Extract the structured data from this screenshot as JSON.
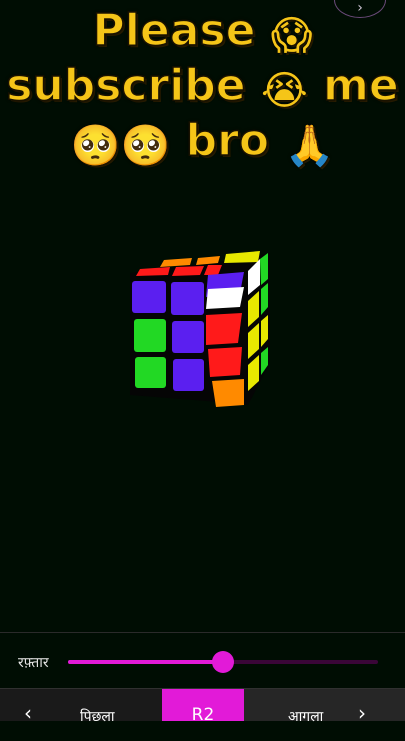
{
  "overlay": {
    "line1": "Please",
    "line1_emoji": "😱",
    "line2": "subscribe",
    "line2_emoji": "😭",
    "line2_end": "me",
    "line3_emoji": "🥺🥺",
    "line3": "bro",
    "line3_end_emoji": "🙏"
  },
  "top_button_icon": "chevron-right-icon",
  "controls": {
    "speed_label": "रफ़्तार",
    "speed_value": 0.5,
    "accent_color": "#e21ad8"
  },
  "nav": {
    "prev_label": "पिछला",
    "current_move": "R2",
    "next_label": "आगला",
    "prev_icon": "chevron-left-icon",
    "next_icon": "chevron-right-icon"
  },
  "cube": {
    "front_face": [
      "#5b1ff0",
      "#5b1ff0",
      "#5b1ff0",
      "#22d824",
      "#5b1ff0",
      "#5b1ff0",
      "#22d824",
      "#5b1ff0",
      "#5b1ff0"
    ],
    "right_face": [
      "#ffffff",
      "#e8e800",
      "#22d824",
      "#ff1a1a",
      "#e8e800",
      "#22d824",
      "#ff1a1a",
      "#e8e800",
      "#e8e800",
      "#ff8a00"
    ],
    "top_face": [
      "#ff8a00",
      "#ff8a00",
      "#e8e800",
      "#ff1a1a",
      "#ff1a1a",
      "#ff1a1a"
    ]
  }
}
